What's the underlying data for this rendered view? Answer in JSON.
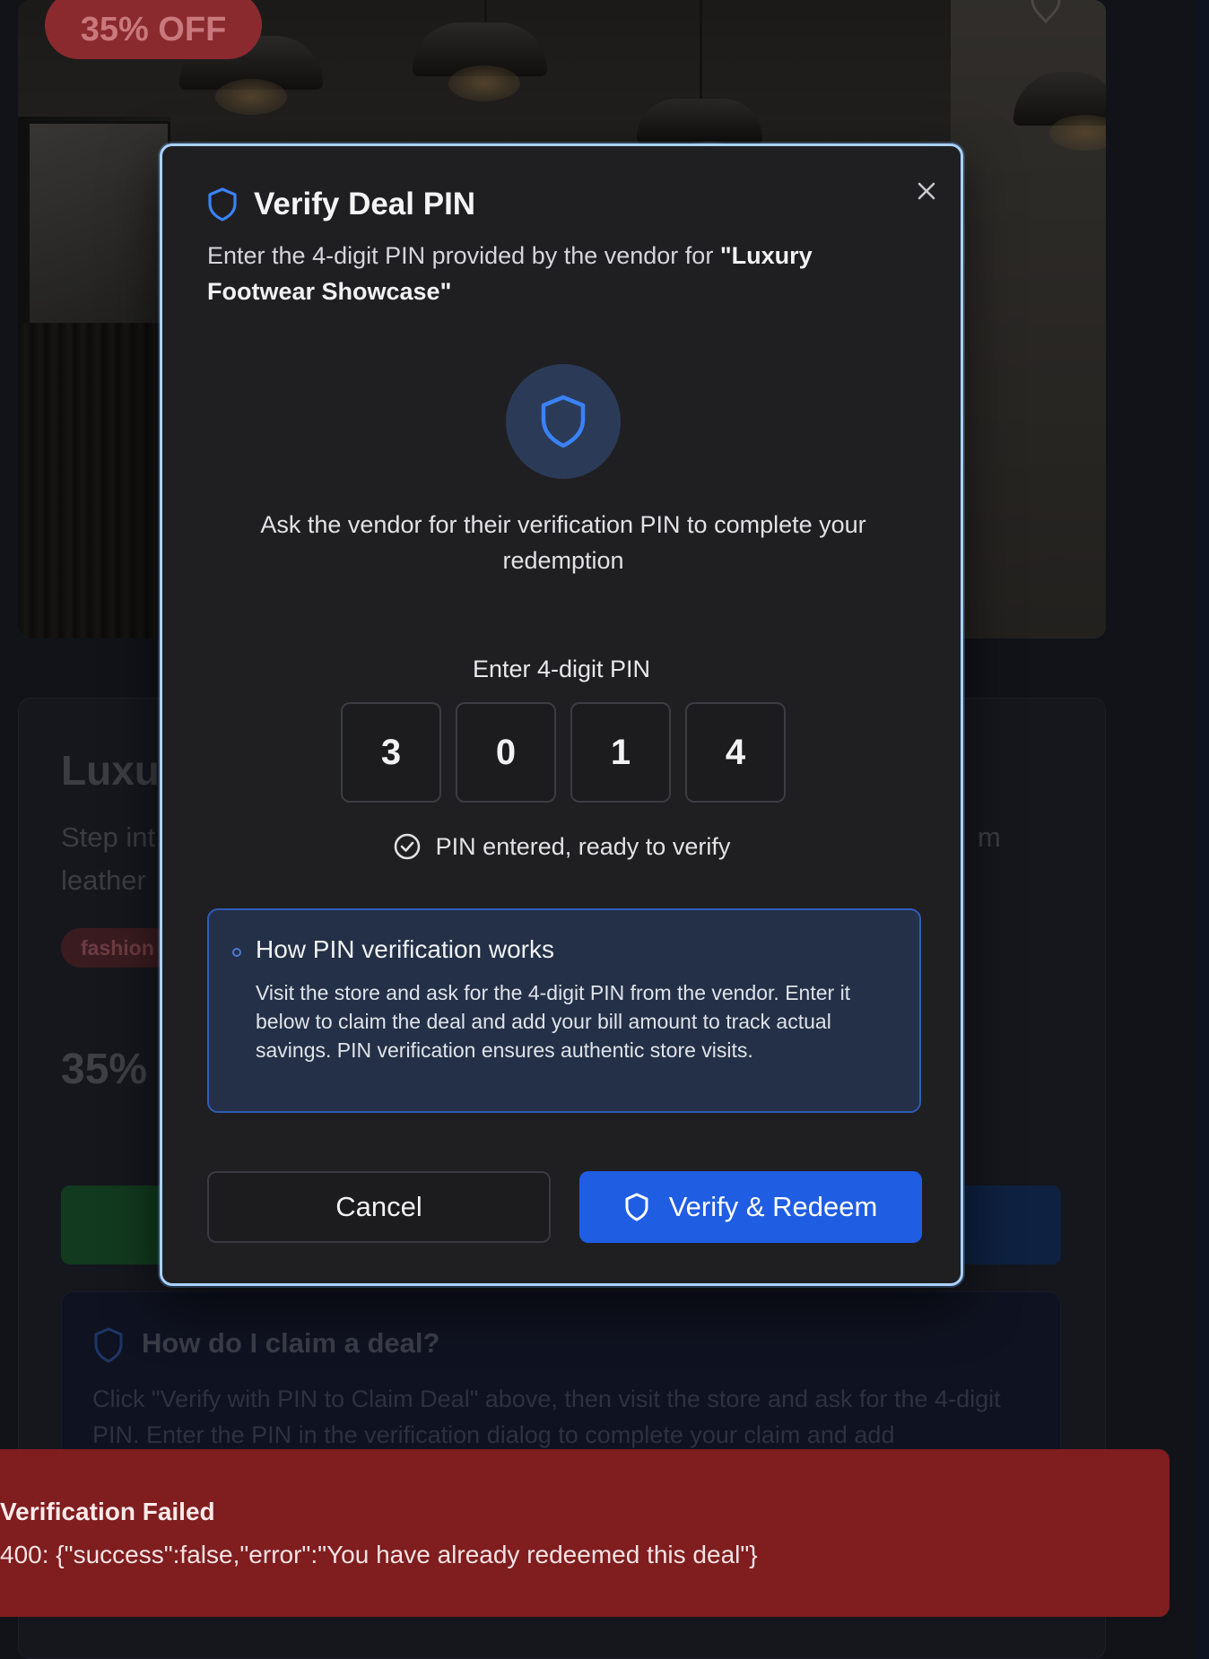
{
  "background": {
    "discount_badge": "35% OFF",
    "deal_title_fragment": "Luxur",
    "desc_line1_left": "Step int",
    "desc_line1_right": "m",
    "desc_line2": "leather",
    "tag": "fashion",
    "price_fragment": "35%",
    "faq": {
      "title": "How do I claim a deal?",
      "text": "Click \"Verify with PIN to Claim Deal\" above, then visit the store and ask for the 4-digit PIN. Enter the PIN in the verification dialog to complete your claim and add"
    }
  },
  "modal": {
    "title": "Verify Deal PIN",
    "description_prefix": "Enter the 4-digit PIN provided by the vendor for ",
    "deal_name": "\"Luxury Footwear Showcase\"",
    "ask_text": "Ask the vendor for their verification PIN to complete your redemption",
    "pin_label": "Enter 4-digit PIN",
    "pin_digits": [
      "3",
      "0",
      "1",
      "4"
    ],
    "pin_status": "PIN entered, ready to verify",
    "info": {
      "title": "How PIN verification works",
      "text": "Visit the store and ask for the 4-digit PIN from the vendor. Enter it below to claim the deal and add your bill amount to track actual savings. PIN verification ensures authentic store visits."
    },
    "cancel_label": "Cancel",
    "verify_label": "Verify & Redeem"
  },
  "toast": {
    "title": "Verification Failed",
    "message": "400: {\"success\":false,\"error\":\"You have already redeemed this deal\"}"
  },
  "colors": {
    "accent": "#1f5ee3",
    "modal_border": "#a9d1ff",
    "error_toast": "#7f1d1f"
  }
}
